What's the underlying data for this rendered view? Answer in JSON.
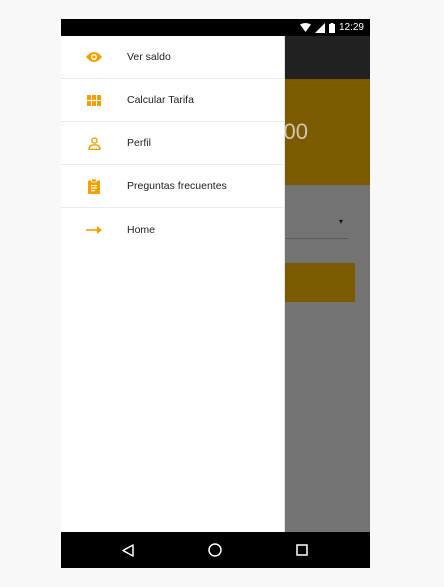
{
  "status_bar": {
    "time": "12:29",
    "icons": [
      "wifi-icon",
      "signal-icon",
      "battery-icon"
    ]
  },
  "app": {
    "banner_text": "00",
    "select_arrow": "▾"
  },
  "drawer": {
    "items": [
      {
        "label": "Ver saldo",
        "icon": "eye-icon"
      },
      {
        "label": "Calcular Tarifa",
        "icon": "grid-icon"
      },
      {
        "label": "Perfil",
        "icon": "person-icon"
      },
      {
        "label": "Preguntas frecuentes",
        "icon": "clipboard-icon"
      },
      {
        "label": "Home",
        "icon": "arrow-right-icon"
      }
    ]
  },
  "nav_bar": {
    "buttons": [
      "back-icon",
      "home-icon",
      "recents-icon"
    ]
  },
  "colors": {
    "accent": "#f5a000",
    "banner": "#7b5a00",
    "toolbar": "#212121",
    "scrim": "#737373"
  }
}
